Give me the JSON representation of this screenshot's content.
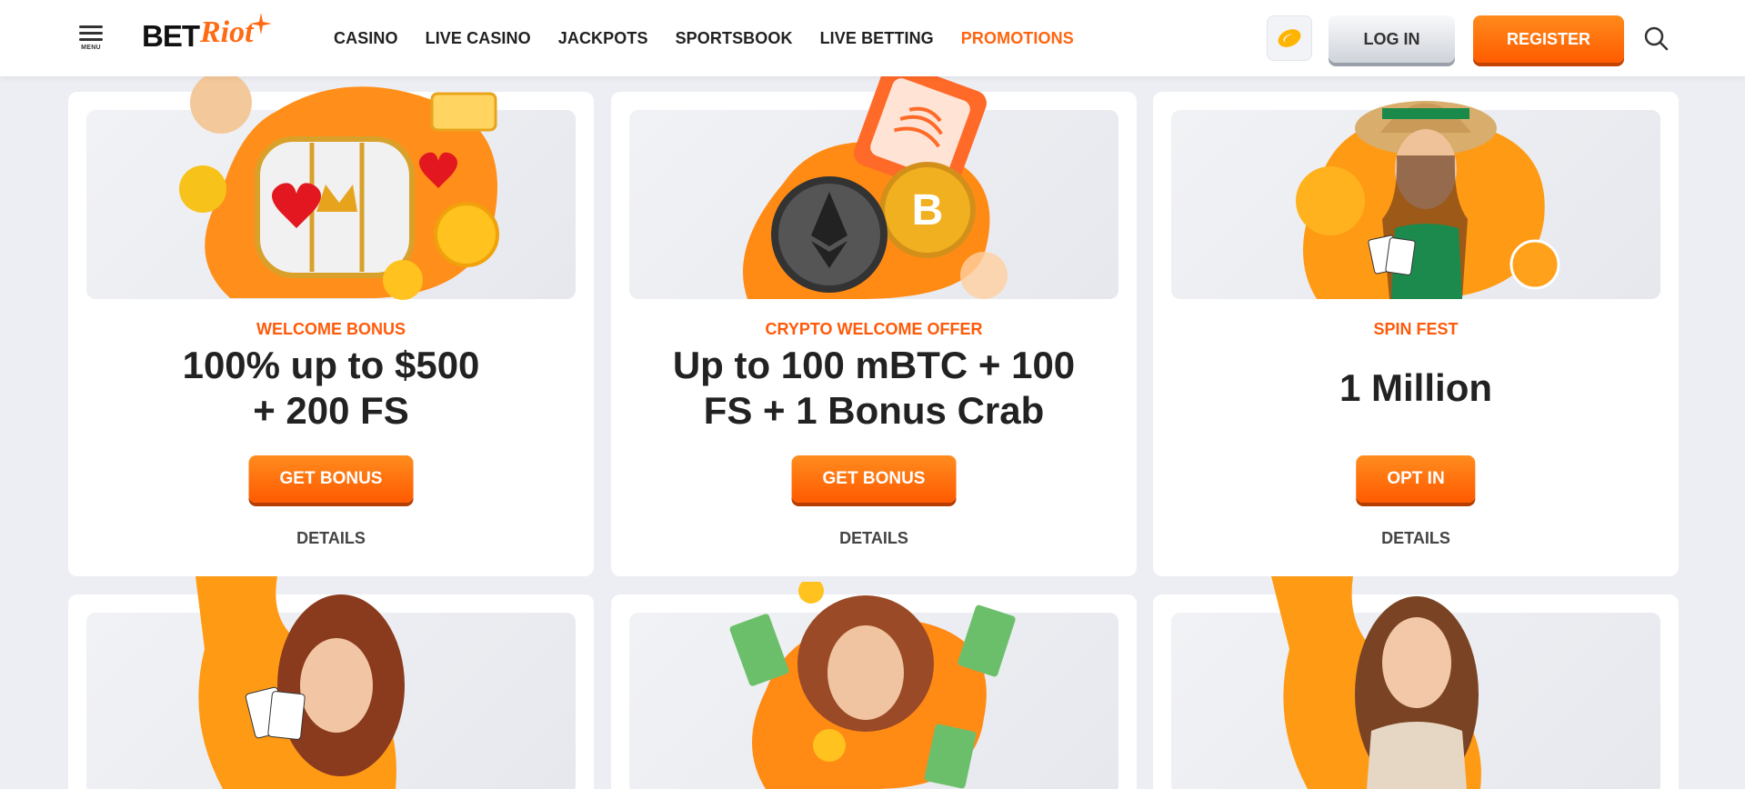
{
  "header": {
    "menu_label": "MENU",
    "logo": {
      "bet": "BET",
      "riot": "Riot"
    },
    "nav": [
      {
        "label": "CASINO",
        "active": false
      },
      {
        "label": "LIVE CASINO",
        "active": false
      },
      {
        "label": "JACKPOTS",
        "active": false
      },
      {
        "label": "SPORTSBOOK",
        "active": false
      },
      {
        "label": "LIVE BETTING",
        "active": false
      },
      {
        "label": "PROMOTIONS",
        "active": true
      }
    ],
    "login_label": "LOG IN",
    "register_label": "REGISTER"
  },
  "promotions": [
    {
      "eyebrow": "WELCOME BONUS",
      "headline_line1": "100% up to $500",
      "headline_line2": "+ 200 FS",
      "cta": "GET BONUS",
      "details": "DETAILS"
    },
    {
      "eyebrow": "CRYPTO WELCOME OFFER",
      "headline_line1": "Up to 100 mBTC + 100",
      "headline_line2": "FS + 1 Bonus Crab",
      "cta": "GET BONUS",
      "details": "DETAILS"
    },
    {
      "eyebrow": "SPIN FEST",
      "headline_line1": "1 Million",
      "headline_line2": "",
      "cta": "OPT IN",
      "details": "DETAILS"
    }
  ],
  "colors": {
    "brand": "#ff6510",
    "background": "#eceef3",
    "card": "#ffffff"
  }
}
